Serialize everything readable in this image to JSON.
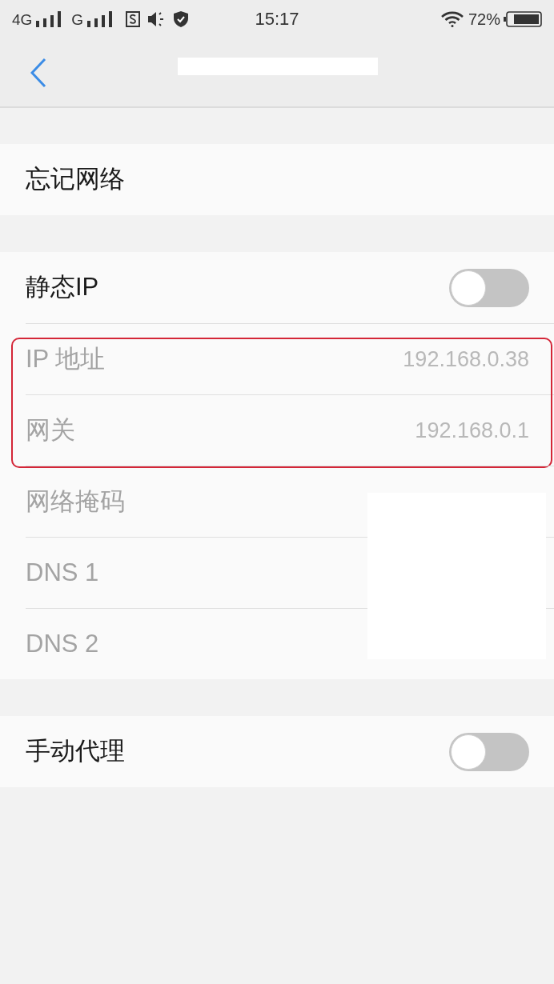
{
  "status_bar": {
    "network_1": "4G",
    "network_2": "G",
    "time": "15:17",
    "battery": "72%"
  },
  "nav_bar": {
    "title_redacted": true
  },
  "sections": [
    {
      "rows": [
        {
          "kind": "action",
          "label": "忘记网络"
        }
      ]
    },
    {
      "rows": [
        {
          "kind": "toggle",
          "label": "静态IP",
          "on": false
        },
        {
          "kind": "field",
          "label": "IP 地址",
          "value": "192.168.0.38",
          "disabled": true,
          "highlighted": true
        },
        {
          "kind": "field",
          "label": "网关",
          "value": "192.168.0.1",
          "disabled": true,
          "highlighted": true
        },
        {
          "kind": "field",
          "label": "网络掩码",
          "disabled": true,
          "redacted": true
        },
        {
          "kind": "field",
          "label": "DNS 1",
          "disabled": true,
          "redacted": true
        },
        {
          "kind": "field",
          "label": "DNS 2",
          "disabled": true,
          "redacted": true
        }
      ]
    },
    {
      "rows": [
        {
          "kind": "toggle",
          "label": "手动代理",
          "on": false
        }
      ]
    }
  ]
}
